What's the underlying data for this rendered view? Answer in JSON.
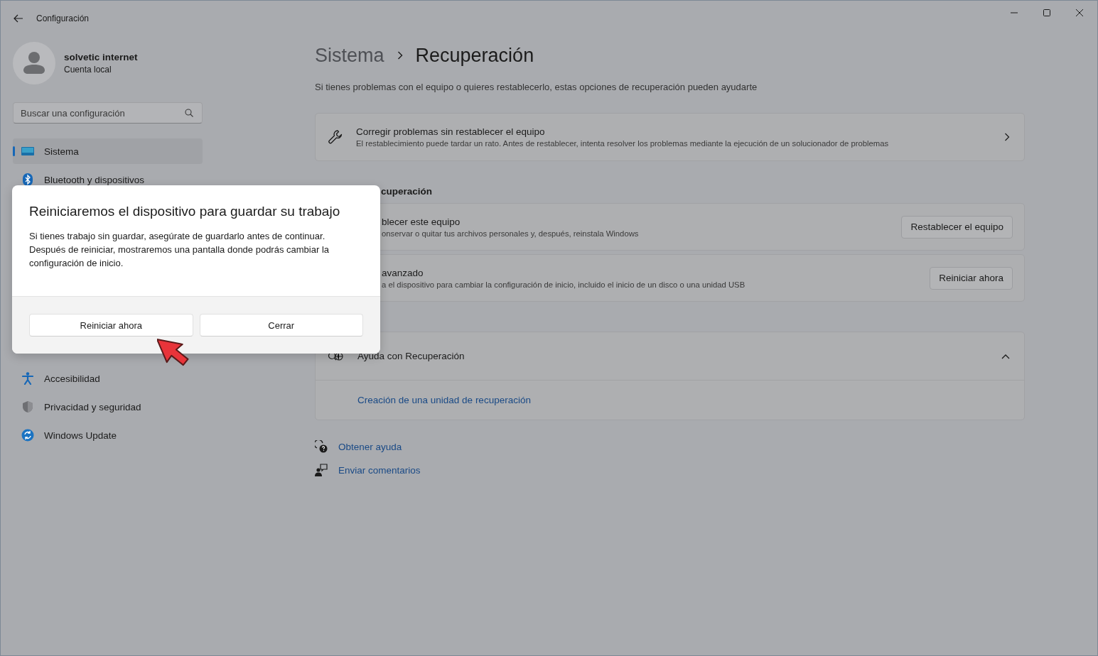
{
  "window": {
    "title": "Configuración"
  },
  "user": {
    "name": "solvetic internet",
    "account": "Cuenta local"
  },
  "search": {
    "placeholder": "Buscar una configuración"
  },
  "sidebar": {
    "items": [
      {
        "label": "Sistema",
        "selected": true
      },
      {
        "label": "Bluetooth y dispositivos",
        "selected": false
      },
      {
        "label": "Accesibilidad",
        "selected": false
      },
      {
        "label": "Privacidad y seguridad",
        "selected": false
      },
      {
        "label": "Windows Update",
        "selected": false
      }
    ]
  },
  "breadcrumb": {
    "parent": "Sistema",
    "current": "Recuperación"
  },
  "description": "Si tienes problemas con el equipo o quieres restablecerlo, estas opciones de recuperación pueden ayudarte",
  "fix_card": {
    "title": "Corregir problemas sin restablecer el equipo",
    "subtitle": "El restablecimiento puede tardar un rato. Antes de restablecer, intenta resolver los problemas mediante la ejecución de un solucionador de problemas"
  },
  "section_title": "cuperación",
  "options": [
    {
      "title": "blecer este equipo",
      "subtitle": "onservar o quitar tus archivos personales y, después, reinstala Windows",
      "button": "Restablecer el equipo"
    },
    {
      "title": "avanzado",
      "subtitle": "a el dispositivo para cambiar la configuración de inicio, incluido el inicio de un disco o una unidad USB",
      "button": "Reiniciar ahora"
    }
  ],
  "help": {
    "title": "Ayuda con Recuperación",
    "expanded": true,
    "links": [
      "Creación de una unidad de recuperación"
    ]
  },
  "footer_links": [
    "Obtener ayuda",
    "Enviar comentarios"
  ],
  "dialog": {
    "title": "Reiniciaremos el dispositivo para guardar su trabajo",
    "body": "Si tienes trabajo sin guardar, asegúrate de guardarlo antes de continuar. Después de reiniciar, mostraremos una pantalla donde podrás cambiar la configuración de inicio.",
    "buttons": [
      "Reiniciar ahora",
      "Cerrar"
    ]
  }
}
